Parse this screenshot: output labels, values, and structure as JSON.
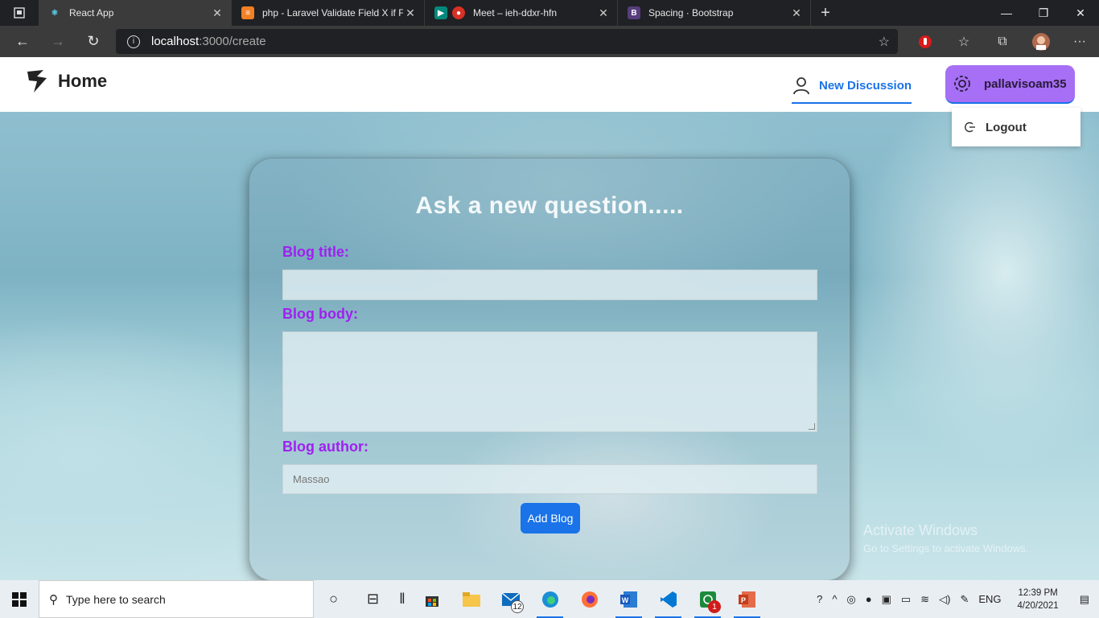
{
  "browser": {
    "tabs": [
      {
        "title": "React App",
        "active": true,
        "icon": "react-icon"
      },
      {
        "title": "php - Laravel Validate Field X if F",
        "active": false,
        "icon": "stackoverflow-icon"
      },
      {
        "title": "Meet – ieh-ddxr-hfn",
        "active": false,
        "icon": "meet-icon"
      },
      {
        "title": "Spacing · Bootstrap",
        "active": false,
        "icon": "bootstrap-icon"
      }
    ],
    "url_host": "localhost",
    "url_path": ":3000/create"
  },
  "navbar": {
    "home_label": "Home",
    "new_discussion_label": "New Discussion",
    "username": "pallavisoam35",
    "logout_label": "Logout"
  },
  "form": {
    "heading": "Ask a new question.....",
    "title_label": "Blog title:",
    "title_value": "",
    "body_label": "Blog body:",
    "body_value": "",
    "author_label": "Blog author:",
    "author_value": "Massao",
    "submit_label": "Add Blog"
  },
  "watermark": {
    "line1": "Activate Windows",
    "line2": "Go to Settings to activate Windows."
  },
  "taskbar": {
    "search_placeholder": "Type here to search",
    "mail_badge": "12",
    "whatsapp_badge": "1",
    "language": "ENG",
    "time": "12:39 PM",
    "date": "4/20/2021"
  },
  "colors": {
    "accent_blue": "#1a73e8",
    "user_button_purple": "#a66ff5",
    "label_purple": "#a020f0"
  }
}
